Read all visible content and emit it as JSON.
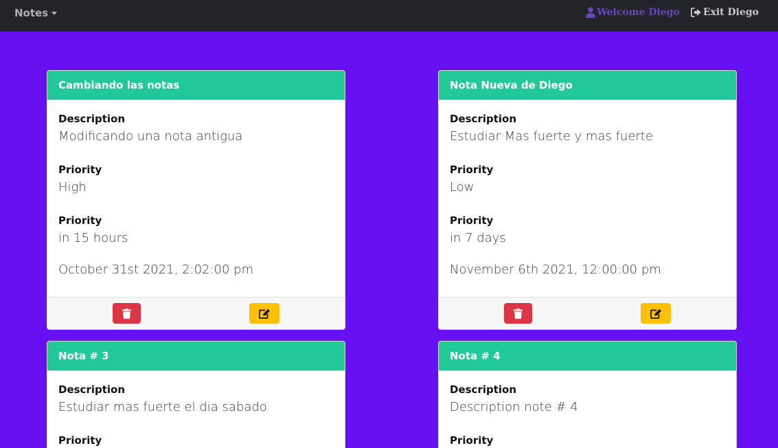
{
  "navbar": {
    "brand": "Notes",
    "welcome": "Welcome Diego",
    "exit": "Exit Diego"
  },
  "labels": {
    "description": "Description",
    "priority": "Priority"
  },
  "notes": [
    {
      "title": "Cambiando las notas",
      "description": "Modificando una nota antigua",
      "priority": "High",
      "relative": "in 15 hours",
      "date": "October 31st 2021, 2:02:00 pm"
    },
    {
      "title": "Nota Nueva de Diego",
      "description": "Estudiar Mas fuerte y mas fuerte",
      "priority": "Low",
      "relative": "in 7 days",
      "date": "November 6th 2021, 12:00:00 pm"
    },
    {
      "title": "Nota # 3",
      "description": "Estudiar mas fuerte el dia sabado"
    },
    {
      "title": "Nota # 4",
      "description": "Description note # 4"
    }
  ],
  "colors": {
    "background": "#6610f2",
    "navbar": "#212529",
    "card_header": "#20c997",
    "delete": "#dc3545",
    "edit": "#ffc107",
    "welcome": "#6f42c1"
  },
  "icons": {
    "welcome": "user-icon",
    "exit": "sign-out-icon",
    "delete": "trash-icon",
    "edit": "edit-icon"
  }
}
